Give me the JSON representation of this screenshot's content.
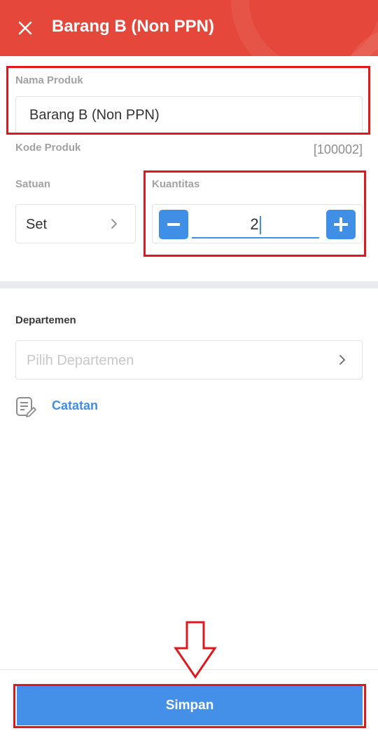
{
  "header": {
    "title": "Barang B (Non PPN)",
    "bg_color": "#e5483a"
  },
  "product_name": {
    "label": "Nama Produk",
    "value": "Barang B (Non PPN)"
  },
  "product_code": {
    "label": "Kode Produk",
    "value": "[100002]"
  },
  "unit": {
    "label": "Satuan",
    "value": "Set"
  },
  "quantity": {
    "label": "Kuantitas",
    "value": "2",
    "minus_icon": "minus-icon",
    "plus_icon": "plus-icon"
  },
  "department": {
    "label": "Departemen",
    "placeholder": "Pilih Departemen"
  },
  "note": {
    "label": "Catatan",
    "icon": "note-icon"
  },
  "footer": {
    "save_label": "Simpan",
    "button_color": "#4490e8"
  },
  "annotations": {
    "highlight_color": "#e0171c"
  }
}
